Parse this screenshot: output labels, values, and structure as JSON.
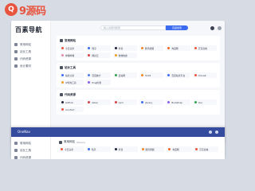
{
  "watermark": {
    "mark": "Q",
    "text": "9源码"
  },
  "app": {
    "brand": "百素导航",
    "search_placeholder": "输入关键词搜索",
    "search_button": "百度搜索",
    "sidebar": [
      {
        "label": "常用网站",
        "icon": "star-icon"
      },
      {
        "label": "站长工具",
        "icon": "tool-icon"
      },
      {
        "label": "代码资源",
        "icon": "code-icon"
      },
      {
        "label": "设计素材",
        "icon": "image-icon"
      }
    ],
    "sections": [
      {
        "title": "常用网站",
        "items": [
          {
            "label": "今日头条",
            "color": "#e8543e"
          },
          {
            "label": "知乎",
            "color": "#3b6cf0"
          },
          {
            "label": "抖音",
            "color": "#1d2230"
          },
          {
            "label": "腾讯视频",
            "color": "#f08a24"
          },
          {
            "label": "淘宝网",
            "color": "#f06624"
          },
          {
            "label": "京东商城",
            "color": "#e8543e"
          },
          {
            "label": "哔哩哔哩",
            "color": "#e88aa8"
          },
          {
            "label": "网易云",
            "color": "#d84040"
          },
          {
            "label": "微博热搜",
            "color": "#f0a020"
          }
        ]
      },
      {
        "title": "站长工具",
        "items": [
          {
            "label": "站长之家",
            "color": "#3b6cf0"
          },
          {
            "label": "百度统计",
            "color": "#4a7cf0"
          },
          {
            "label": "爱站网",
            "color": "#2ea44f"
          },
          {
            "label": "5118",
            "color": "#f08a24"
          },
          {
            "label": "百度站长平台",
            "color": "#3b6cf0"
          },
          {
            "label": "ChinaZ",
            "color": "#e8543e"
          },
          {
            "label": "IP查询工具",
            "color": "#f0a020"
          },
          {
            "label": "Ping检测",
            "color": "#8a5cf0"
          }
        ]
      },
      {
        "title": "代码资源",
        "items": [
          {
            "label": "GitHub",
            "color": "#1d2230"
          },
          {
            "label": "Gitee",
            "color": "#d84040"
          },
          {
            "label": "npm",
            "color": "#d84040"
          },
          {
            "label": "jQuery",
            "color": "#3b6cf0"
          },
          {
            "label": "Bootstrap",
            "color": "#8a5cf0"
          },
          {
            "label": "Vue",
            "color": "#2ea44f"
          },
          {
            "label": "Iconfont",
            "color": "#e8543e"
          }
        ]
      }
    ]
  },
  "overlay": {
    "title": "OneNav",
    "sidebar": [
      {
        "label": "常用网站"
      },
      {
        "label": "站长工具"
      },
      {
        "label": "代码资源"
      }
    ],
    "section_title": "常用网站",
    "section_sub": "Website",
    "items": [
      {
        "label": "今日头条",
        "color": "#e8543e"
      },
      {
        "label": "知乎",
        "color": "#3b6cf0"
      },
      {
        "label": "抖音",
        "color": "#1d2230"
      },
      {
        "label": "腾讯视频",
        "color": "#f08a24"
      },
      {
        "label": "淘宝网",
        "color": "#f06624"
      },
      {
        "label": "京东商城",
        "color": "#e8543e"
      }
    ]
  }
}
